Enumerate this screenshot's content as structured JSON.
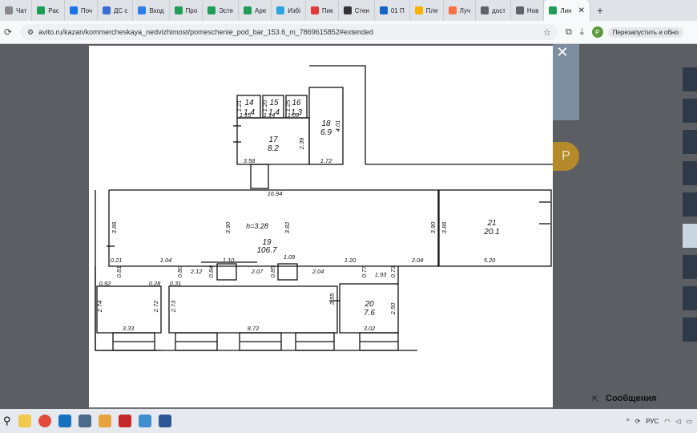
{
  "browser": {
    "tabs": [
      {
        "label": "Чат",
        "icon_color": "#888888"
      },
      {
        "label": "Рас",
        "icon_color": "#1e9e57"
      },
      {
        "label": "Поч",
        "icon_color": "#1a73e8"
      },
      {
        "label": "ДС с",
        "icon_color": "#3b6bd6"
      },
      {
        "label": "Вход",
        "icon_color": "#2b7de9"
      },
      {
        "label": "Про",
        "icon_color": "#1e9e57"
      },
      {
        "label": "Эсте",
        "icon_color": "#1e9e57"
      },
      {
        "label": "Аре",
        "icon_color": "#1e9e57"
      },
      {
        "label": "Избі",
        "icon_color": "#2aa3e0"
      },
      {
        "label": "Пик",
        "icon_color": "#e53935"
      },
      {
        "label": "Стен",
        "icon_color": "#333333"
      },
      {
        "label": "01 П",
        "icon_color": "#1565c0"
      },
      {
        "label": "Пле",
        "icon_color": "#f4b400"
      },
      {
        "label": "Луч",
        "icon_color": "#ff7043"
      },
      {
        "label": "дост",
        "icon_color": "#5f6368"
      },
      {
        "label": "Нов",
        "icon_color": "#5f6368"
      },
      {
        "label": "Лин",
        "icon_color": "#1e9e57",
        "active": true
      }
    ],
    "url": "avito.ru/kazan/kommercheskaya_nedvizhimost/pomeschenie_pod_bar_153.6_m_7869615852#extended",
    "restart_label": "Перезапустить и обно",
    "profile_initial": "P"
  },
  "page": {
    "avatar_initial": "P",
    "messages_label": "Сообщения"
  },
  "floorplan": {
    "rooms": [
      {
        "num": "14",
        "area": "1.4"
      },
      {
        "num": "15",
        "area": "1.4"
      },
      {
        "num": "16",
        "area": "1.3"
      },
      {
        "num": "18",
        "area": "6.9"
      },
      {
        "num": "17",
        "area": "8.2"
      },
      {
        "num": "19",
        "area": "106.7"
      },
      {
        "num": "21",
        "area": "20.1"
      },
      {
        "num": "20",
        "area": "7.6"
      }
    ],
    "height_label": "h=3.28",
    "dims": [
      "1.21",
      "1.20",
      "1.25",
      "1.15",
      "1.14",
      "1.09",
      "4.01",
      "2.39",
      "3.58",
      "1.72",
      "16.94",
      "3.86",
      "3.90",
      "3.82",
      "3.90",
      "3.86",
      "0.21",
      "0.81",
      "1.04",
      "0.80",
      "1.10",
      "1.09",
      "1.20",
      "0.77",
      "0.73",
      "2.04",
      "5.20",
      "0.92",
      "0.28",
      "0.31",
      "2.12",
      "0.84",
      "2.07",
      "0.85",
      "2.04",
      "1.93",
      "2.74",
      "2.72",
      "2.73",
      "3.55",
      "2.50",
      "3.33",
      "8.72",
      "3.02"
    ]
  },
  "taskbar": {
    "lang": "РУС"
  }
}
